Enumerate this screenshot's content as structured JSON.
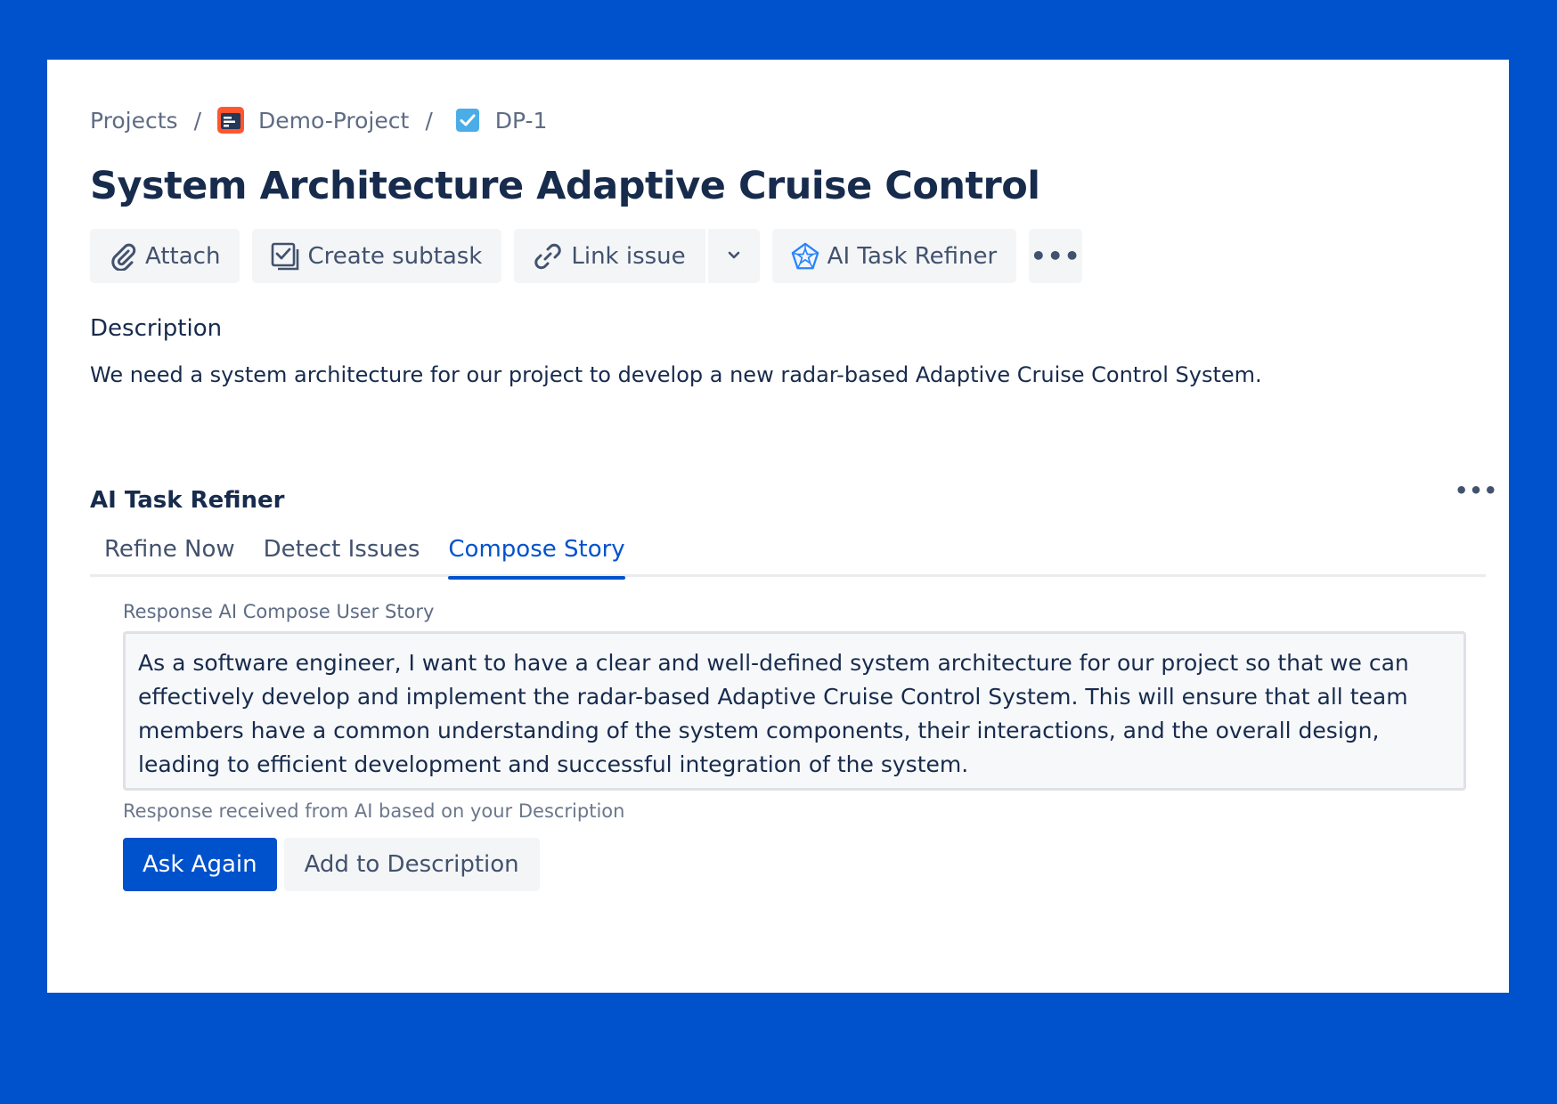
{
  "breadcrumb": {
    "projects": "Projects",
    "separator": "/",
    "project_name": "Demo-Project",
    "project_icon": "project-board-icon",
    "issue_key": "DP-1",
    "issue_icon": "task-checkbox-icon"
  },
  "page_title": "System Architecture Adaptive Cruise Control",
  "toolbar": {
    "attach_label": "Attach",
    "attach_icon": "paperclip-icon",
    "create_subtask_label": "Create subtask",
    "create_subtask_icon": "subtask-icon",
    "link_issue_label": "Link issue",
    "link_issue_icon": "link-icon",
    "link_dropdown_icon": "chevron-down-icon",
    "ai_task_refiner_label": "AI Task Refiner",
    "ai_task_refiner_icon": "pentagon-star-icon",
    "more_label": "•••"
  },
  "description": {
    "heading": "Description",
    "text": "We need a system architecture for our project to develop a new radar-based Adaptive Cruise Control System."
  },
  "ai_panel": {
    "heading": "AI Task Refiner",
    "more_label": "•••",
    "tabs": [
      {
        "label": "Refine Now",
        "active": false
      },
      {
        "label": "Detect Issues",
        "active": false
      },
      {
        "label": "Compose Story",
        "active": true
      }
    ],
    "response_label": "Response AI Compose User Story",
    "response_text": "As a software engineer, I want to have a clear and well-defined system architecture for our project so that we can effectively develop and implement the radar-based Adaptive Cruise Control System. This will ensure that all team members have a common understanding of the system components, their interactions, and the overall design, leading to efficient development and successful integration of the system.",
    "response_help": "Response received from AI based on your Description",
    "ask_again_label": "Ask Again",
    "add_to_description_label": "Add to Description"
  },
  "colors": {
    "background": "#0052cc",
    "primary": "#0052cc",
    "text": "#172b4d",
    "subtle_text": "#5e6c84",
    "button_bg": "#f4f5f7"
  }
}
